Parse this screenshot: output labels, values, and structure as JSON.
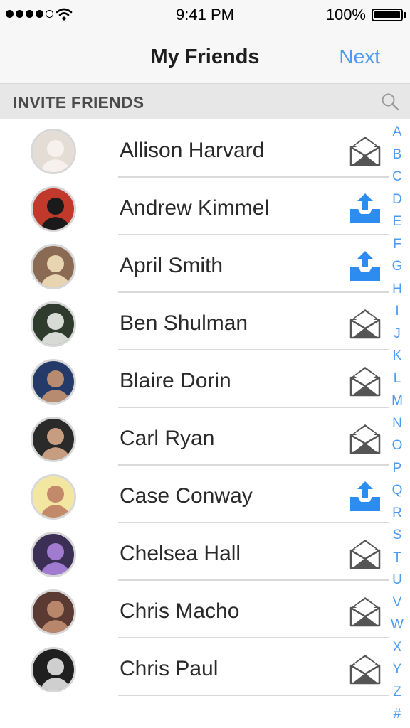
{
  "status_bar": {
    "time": "9:41 PM",
    "battery": "100%"
  },
  "nav": {
    "title": "My Friends",
    "next_label": "Next"
  },
  "section": {
    "title": "INVITE FRIENDS"
  },
  "friends": [
    {
      "name": "Allison Harvard",
      "action": "envelope-icon",
      "avatar_bg": "#e4ddd5",
      "avatar_fg": "#f6f1ec"
    },
    {
      "name": "Andrew Kimmel",
      "action": "upload-icon",
      "avatar_bg": "#c0392b",
      "avatar_fg": "#1a1a1a"
    },
    {
      "name": "April Smith",
      "action": "upload-icon",
      "avatar_bg": "#8a6a52",
      "avatar_fg": "#e8d4b0"
    },
    {
      "name": "Ben Shulman",
      "action": "envelope-icon",
      "avatar_bg": "#2f3b2c",
      "avatar_fg": "#d8dad6"
    },
    {
      "name": "Blaire Dorin",
      "action": "envelope-icon",
      "avatar_bg": "#243a68",
      "avatar_fg": "#b78b6f"
    },
    {
      "name": "Carl Ryan",
      "action": "envelope-icon",
      "avatar_bg": "#2a2a2a",
      "avatar_fg": "#c79d82"
    },
    {
      "name": "Case Conway",
      "action": "upload-icon",
      "avatar_bg": "#f2e6a0",
      "avatar_fg": "#c28a6a"
    },
    {
      "name": "Chelsea Hall",
      "action": "envelope-icon",
      "avatar_bg": "#3b2f55",
      "avatar_fg": "#a07bd0"
    },
    {
      "name": "Chris Macho",
      "action": "envelope-icon",
      "avatar_bg": "#5a3a33",
      "avatar_fg": "#b8876b"
    },
    {
      "name": "Chris Paul",
      "action": "envelope-icon",
      "avatar_bg": "#1f1f1f",
      "avatar_fg": "#cfcfcf"
    }
  ],
  "alpha_index": [
    "A",
    "B",
    "C",
    "D",
    "E",
    "F",
    "G",
    "H",
    "I",
    "J",
    "K",
    "L",
    "M",
    "N",
    "O",
    "P",
    "Q",
    "R",
    "S",
    "T",
    "U",
    "V",
    "W",
    "X",
    "Y",
    "Z",
    "#"
  ],
  "colors": {
    "accent": "#4a9bf5",
    "envelope": "#555555",
    "upload": "#2d8cf0"
  }
}
